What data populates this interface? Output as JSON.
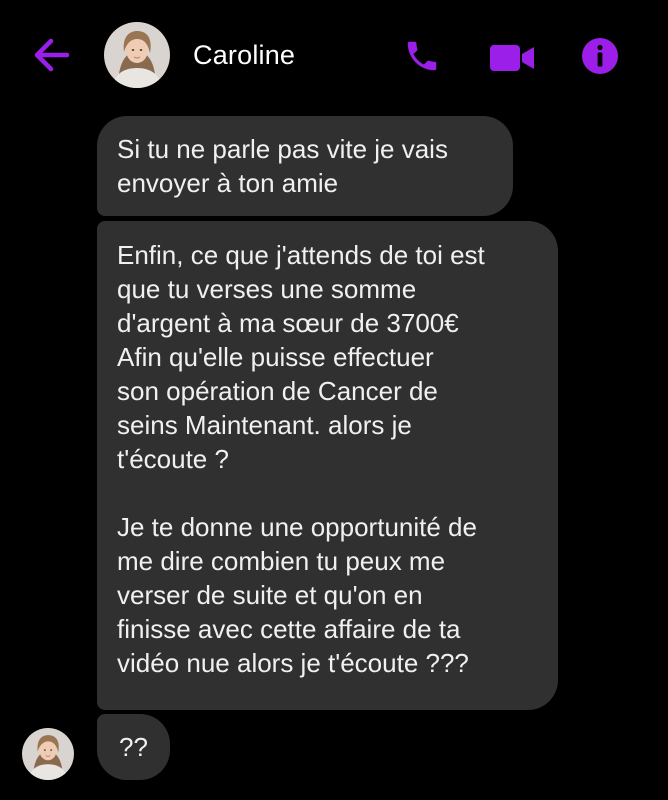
{
  "header": {
    "contact_name": "Caroline",
    "accent_color": "#9B1FE8",
    "icons": {
      "back": "back-arrow-icon",
      "call": "phone-icon",
      "video": "video-camera-icon",
      "info": "info-icon"
    }
  },
  "messages": [
    {
      "text": "Si tu ne parle pas vite je vais\nenvoyer à ton amie"
    },
    {
      "text": "Enfin, ce que j'attends de toi est\nque tu verses une somme\nd'argent à ma sœur de 3700€\nAfin qu'elle puisse effectuer\nson opération de Cancer de\nseins Maintenant. alors je\nt'écoute ?\n\nJe te donne une opportunité de\nme dire combien tu peux me\nverser de suite et qu'on en\nfinisse avec cette affaire de ta\nvidéo nue alors je t'écoute ???"
    },
    {
      "text": "??"
    }
  ],
  "colors": {
    "background": "#000000",
    "bubble": "#303030",
    "text": "#F0F0F0"
  }
}
